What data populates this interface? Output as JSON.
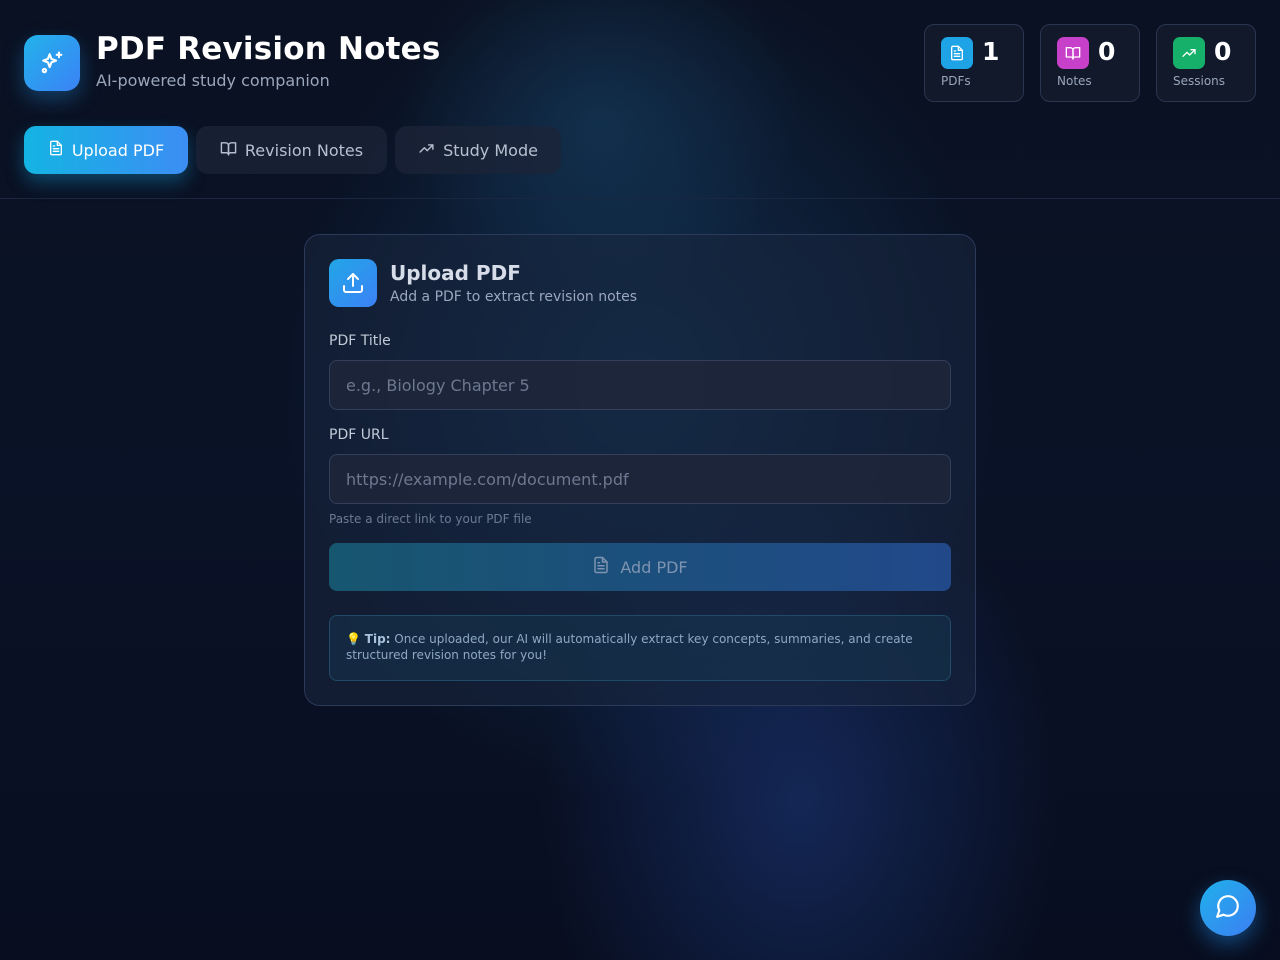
{
  "app": {
    "title": "PDF Revision Notes",
    "subtitle": "AI-powered study companion",
    "logo_icon": "sparkles-icon"
  },
  "stats": [
    {
      "value": "1",
      "label": "PDFs",
      "icon": "file-icon",
      "color": "#1ea4e6"
    },
    {
      "value": "0",
      "label": "Notes",
      "icon": "book-icon",
      "color": "#c640c9"
    },
    {
      "value": "0",
      "label": "Sessions",
      "icon": "trending-up-icon",
      "color": "#16b06a"
    }
  ],
  "tabs": [
    {
      "label": "Upload PDF",
      "icon": "file-icon",
      "active": true
    },
    {
      "label": "Revision Notes",
      "icon": "book-icon",
      "active": false
    },
    {
      "label": "Study Mode",
      "icon": "trending-up-icon",
      "active": false
    }
  ],
  "upload_card": {
    "title": "Upload PDF",
    "subtitle": "Add a PDF to extract revision notes",
    "icon": "upload-icon",
    "title_field": {
      "label": "PDF Title",
      "placeholder": "e.g., Biology Chapter 5",
      "value": ""
    },
    "url_field": {
      "label": "PDF URL",
      "placeholder": "https://example.com/document.pdf",
      "value": "",
      "hint": "Paste a direct link to your PDF file"
    },
    "add_button": {
      "label": "Add PDF",
      "icon": "file-icon",
      "disabled": true
    },
    "tip": {
      "emoji": "💡",
      "heading": "Tip:",
      "text": "Once uploaded, our AI will automatically extract key concepts, summaries, and create structured revision notes for you!"
    }
  },
  "chat_button": {
    "icon": "message-circle-icon"
  },
  "colors": {
    "accent": "#13b4e2",
    "accent_2": "#3c8ef4",
    "background": "#0a1122"
  }
}
